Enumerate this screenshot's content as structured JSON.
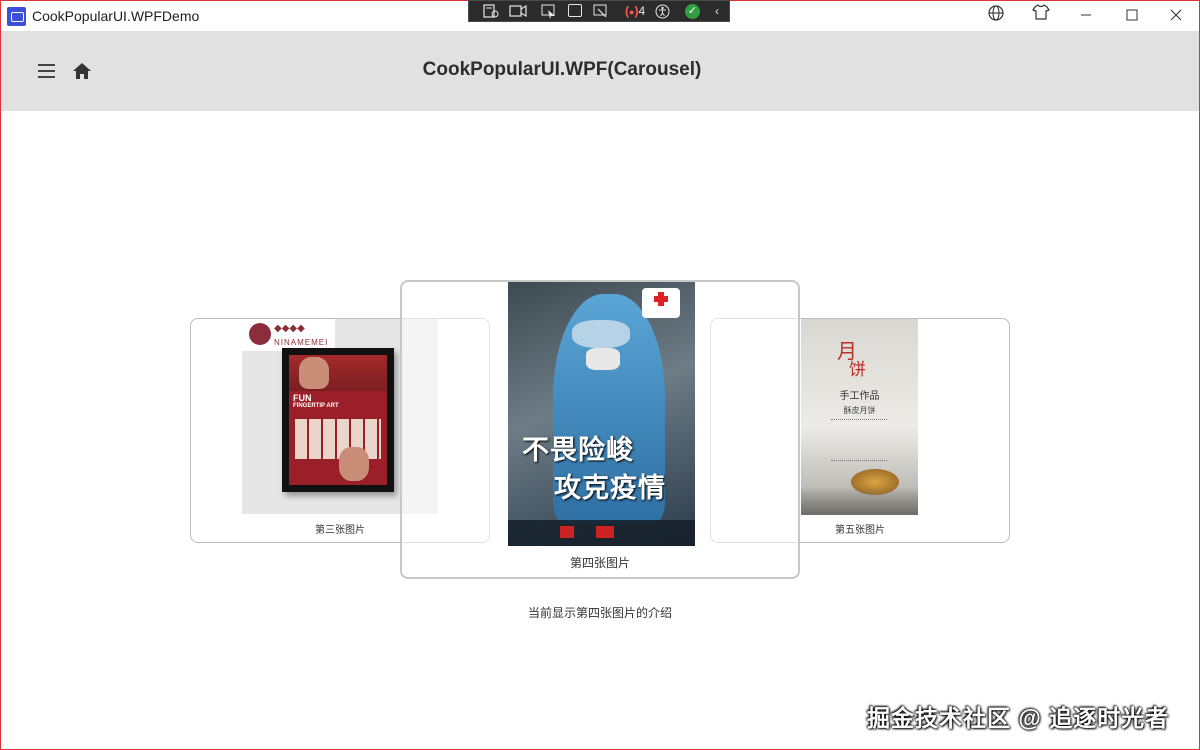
{
  "window": {
    "title": "CookPopularUI.WPFDemo"
  },
  "debug_toolbar": {
    "binding_count": "4"
  },
  "header": {
    "title": "CookPopularUI.WPF(Carousel)"
  },
  "carousel": {
    "items": [
      {
        "caption": "第三张图片",
        "brand": "NINAMEMEI",
        "poster_text": [
          "FUN",
          "FINGERTIP ART"
        ]
      },
      {
        "caption": "第四张图片",
        "poster_text": [
          "不畏险峻",
          "攻克疫情"
        ]
      },
      {
        "caption": "第五张图片",
        "poster_text": [
          "手工作品",
          "酥皮月饼"
        ]
      }
    ],
    "description": "当前显示第四张图片的介绍"
  },
  "watermark": "掘金技术社区 @ 追逐时光者"
}
